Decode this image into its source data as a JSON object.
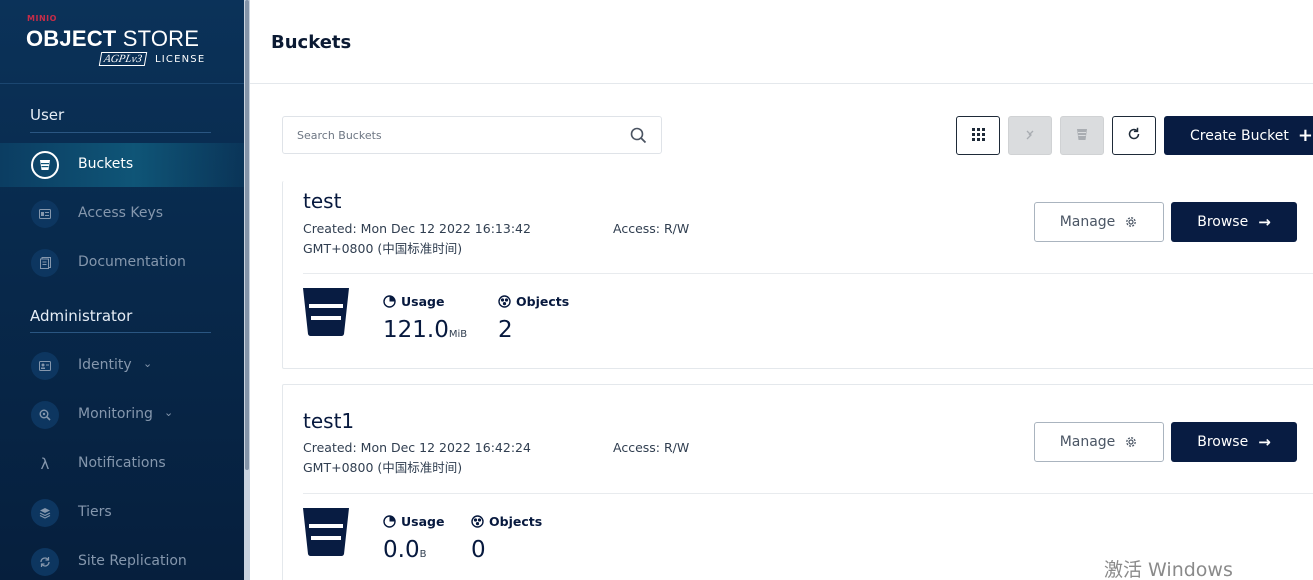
{
  "brand": {
    "minio": "MINIO",
    "product_bold": "OBJECT",
    "product_light": "STORE",
    "badge": "AGPLv3",
    "license": "LICENSE"
  },
  "sidebar": {
    "user_section": "User",
    "admin_section": "Administrator",
    "user_items": [
      {
        "label": "Buckets",
        "icon": "bucket-icon",
        "active": true
      },
      {
        "label": "Access Keys",
        "icon": "id-card-icon"
      },
      {
        "label": "Documentation",
        "icon": "document-icon"
      }
    ],
    "admin_items": [
      {
        "label": "Identity",
        "icon": "identity-icon",
        "expandable": true
      },
      {
        "label": "Monitoring",
        "icon": "monitoring-icon",
        "expandable": true
      },
      {
        "label": "Notifications",
        "icon": "lambda-icon"
      },
      {
        "label": "Tiers",
        "icon": "tiers-icon"
      },
      {
        "label": "Site Replication",
        "icon": "replication-icon"
      }
    ]
  },
  "header": {
    "title": "Buckets"
  },
  "search": {
    "placeholder": "Search Buckets",
    "value": ""
  },
  "toolbar": {
    "create_label": "Create Bucket",
    "create_icon": "+"
  },
  "buckets": [
    {
      "name": "test",
      "created": "Created: Mon Dec 12 2022 16:13:42 GMT+0800 (中国标准时间)",
      "access": "Access: R/W",
      "manage": "Manage",
      "browse": "Browse",
      "usage_label": "Usage",
      "usage_value": "121.0",
      "usage_unit": "MiB",
      "objects_label": "Objects",
      "objects_value": "2"
    },
    {
      "name": "test1",
      "created": "Created: Mon Dec 12 2022 16:42:24 GMT+0800 (中国标准时间)",
      "access": "Access: R/W",
      "manage": "Manage",
      "browse": "Browse",
      "usage_label": "Usage",
      "usage_value": "0.0",
      "usage_unit": "B",
      "objects_label": "Objects",
      "objects_value": "0"
    }
  ],
  "watermark": "激活 Windows",
  "colors": {
    "primary": "#081c42",
    "sidebar": "#082a4d",
    "accent_red": "#c72c48"
  }
}
